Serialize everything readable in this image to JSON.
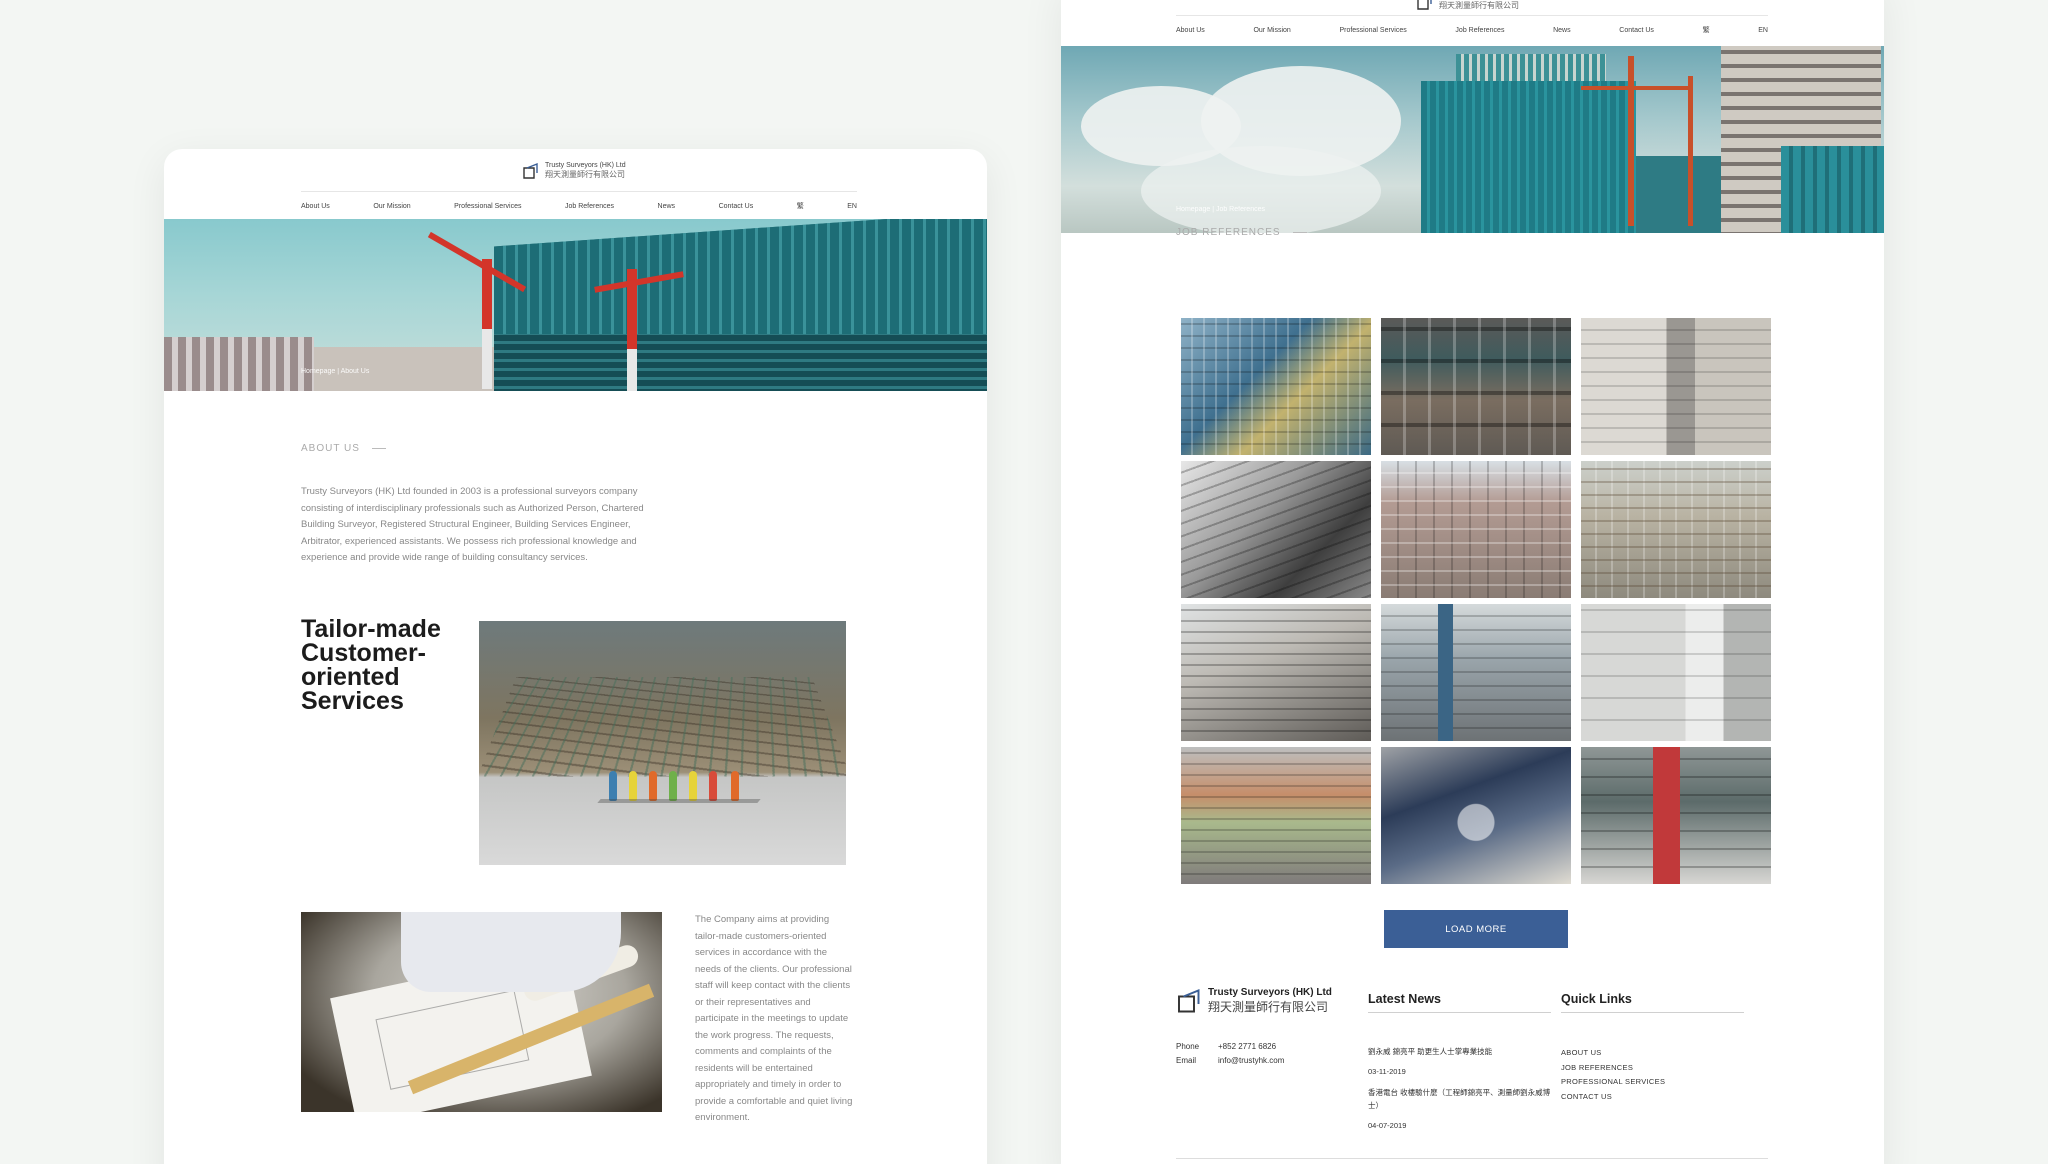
{
  "brand": {
    "name_en": "Trusty Surveyors (HK) Ltd",
    "name_zh": "翔天測量師行有限公司",
    "brand_color": "#3b5f96"
  },
  "nav": {
    "items": [
      "About Us",
      "Our Mission",
      "Professional Services",
      "Job References",
      "News",
      "Contact Us"
    ],
    "lang_zh": "繁",
    "lang_en": "EN"
  },
  "about_page": {
    "breadcrumb": "Homepage | About Us",
    "section_title": "ABOUT US",
    "intro": "Trusty Surveyors (HK) Ltd founded in 2003 is a professional surveyors company consisting of interdisciplinary professionals such as Authorized Person, Chartered Building Surveyor, Registered Structural Engineer, Building Services Engineer, Arbitrator, experienced assistants. We possess rich professional knowledge and experience and provide wide range of building consultancy services.",
    "headline": "Tailor-made Customer-oriented Services",
    "description": "The Company aims at providing tailor-made customers-oriented services in accordance with the needs of the clients. Our professional staff will keep contact with the clients or their representatives and participate in the meetings to update the work progress. The requests, comments and complaints of the residents will be entertained appropriately and timely in order to provide a comfortable and quiet living environment."
  },
  "job_page": {
    "breadcrumb": "Homepage | Job References",
    "section_title": "JOB REFERENCES",
    "load_more": "LOAD MORE"
  },
  "footer": {
    "phone_label": "Phone",
    "phone": "+852 2771 6826",
    "email_label": "Email",
    "email": "info@trustyhk.com",
    "latest_news_title": "Latest News",
    "news": [
      {
        "title": "劉永威 錦亮平 助更生人士掌專業技能",
        "date": "03-11-2019"
      },
      {
        "title": "香港電台 收樓驗什麼（工程師錦亮平、測量師劉永威博士）",
        "date": "04-07-2019"
      }
    ],
    "quick_links_title": "Quick Links",
    "quick_links": [
      "ABOUT US",
      "JOB REFERENCES",
      "PROFESSIONAL SERVICES",
      "CONTACT US"
    ]
  }
}
